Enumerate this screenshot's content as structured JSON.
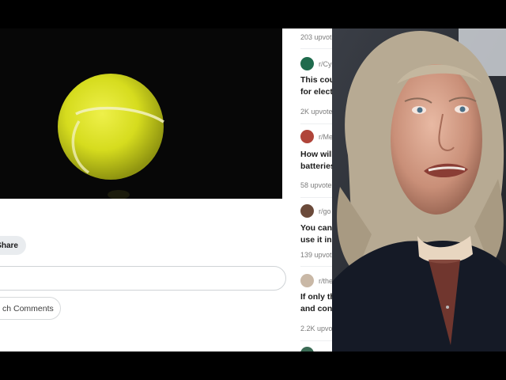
{
  "post": {
    "share_label": "Share",
    "comment_placeholder": "",
    "search_comments_label": "ch Comments"
  },
  "sidebar": {
    "top_upvotes": "203 upvote",
    "items": [
      {
        "subreddit": "r/Cy",
        "title_line1": "This cou",
        "title_line2": "for elect",
        "upvotes": "2K upvote",
        "avatar_color": "#1f6b4d"
      },
      {
        "subreddit": "r/Me",
        "title_line1": "How will",
        "title_line2": "batteries",
        "upvotes": "58 upvote",
        "avatar_color": "#b0453a"
      },
      {
        "subreddit": "r/go",
        "title_line1": "You can",
        "title_line2": "use it in",
        "upvotes": "139 upvot",
        "avatar_color": "#6b4a3a"
      },
      {
        "subreddit": "r/the",
        "title_line1": "If only th",
        "title_line2": "and conf",
        "upvotes": "2.2K upvo",
        "avatar_color": "#c9b8a6"
      }
    ]
  },
  "colors": {
    "video_bg": "#070707",
    "tennis_ball": "#d9e021",
    "page_bg": "#ffffff",
    "letterbox": "#000000"
  }
}
